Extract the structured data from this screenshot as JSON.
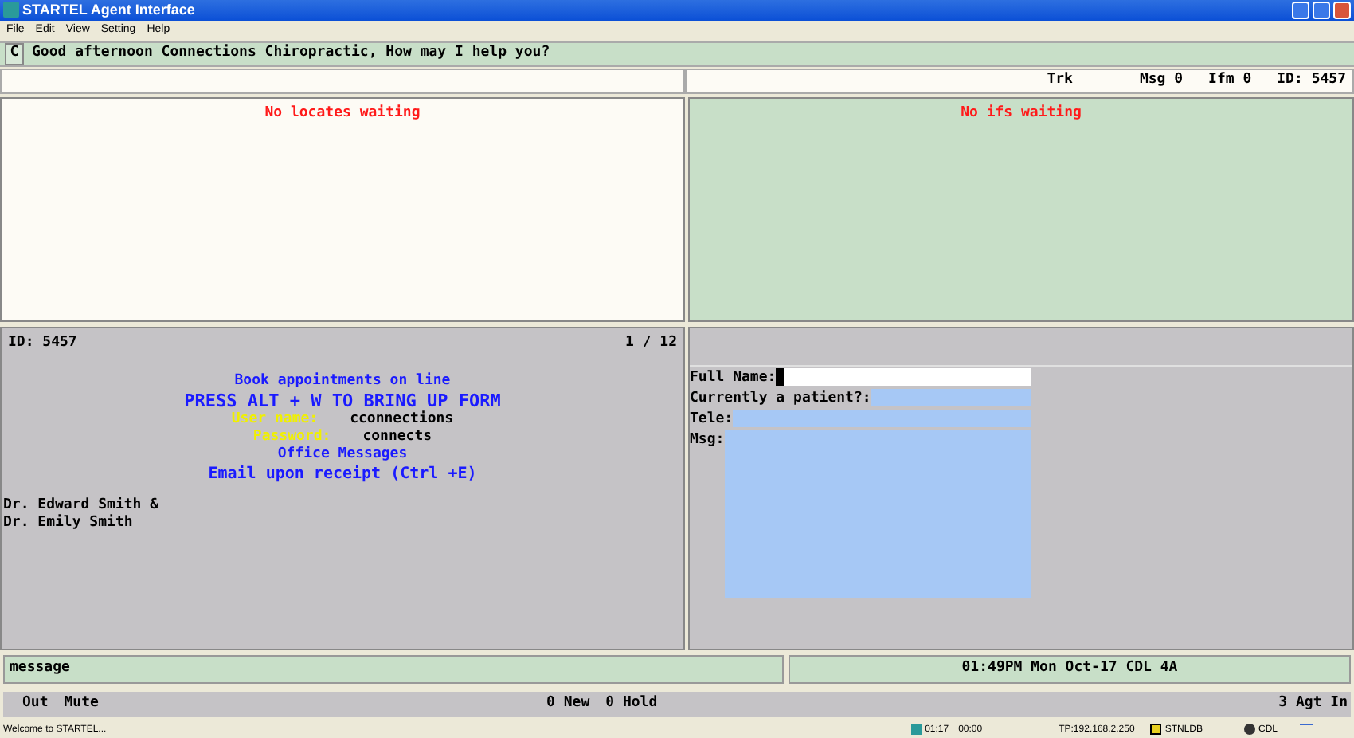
{
  "window": {
    "title": "STARTEL Agent Interface"
  },
  "menu": [
    "File",
    "Edit",
    "View",
    "Setting",
    "Help"
  ],
  "greeting": {
    "badge": "C",
    "text": "Good afternoon Connections Chiropractic, How may I help you?"
  },
  "info_bar": [
    "Trk",
    "Msg 0",
    "Ifm 0",
    "ID: 5457"
  ],
  "locates_panel": {
    "message": "No locates waiting"
  },
  "ifs_panel": {
    "message": "No ifs waiting"
  },
  "script_panel": {
    "id": "ID: 5457",
    "page": "1 / 12",
    "lines": [
      {
        "kind": "small",
        "text": "Book appointments on line"
      },
      {
        "kind": "large",
        "text": "PRESS ALT + W TO BRING UP FORM"
      },
      {
        "kind": "credential",
        "label": "User name:",
        "value": "cconnections"
      },
      {
        "kind": "credential",
        "label": "Password:",
        "value": "connects"
      },
      {
        "kind": "small",
        "text": "Office Messages"
      },
      {
        "kind": "medium",
        "text": "Email upon receipt (Ctrl +E)"
      }
    ],
    "notes": [
      "Dr. Edward Smith &",
      "Dr. Emily Smith"
    ]
  },
  "form": {
    "fields": [
      {
        "label": "Full Name:",
        "kind": "line",
        "focused": true
      },
      {
        "label": "Currently a patient?:",
        "kind": "line",
        "focused": false
      },
      {
        "label": "Tele:",
        "kind": "line",
        "focused": false
      },
      {
        "label": "Msg:",
        "kind": "area",
        "focused": false
      }
    ]
  },
  "message_bar": {
    "text": "message",
    "clock": "01:49PM Mon Oct-17 CDL 4A"
  },
  "call_bar": {
    "left": [
      "Out",
      "Mute"
    ],
    "counts": [
      "0 New",
      "0 Hold"
    ],
    "agents": "3 Agt In"
  },
  "status_bar": {
    "text": "Welcome to STARTEL...",
    "time": "01:17",
    "timer": "00:00",
    "address": "TP:192.168.2.250",
    "database": "STNLDB",
    "user": "CDL"
  }
}
